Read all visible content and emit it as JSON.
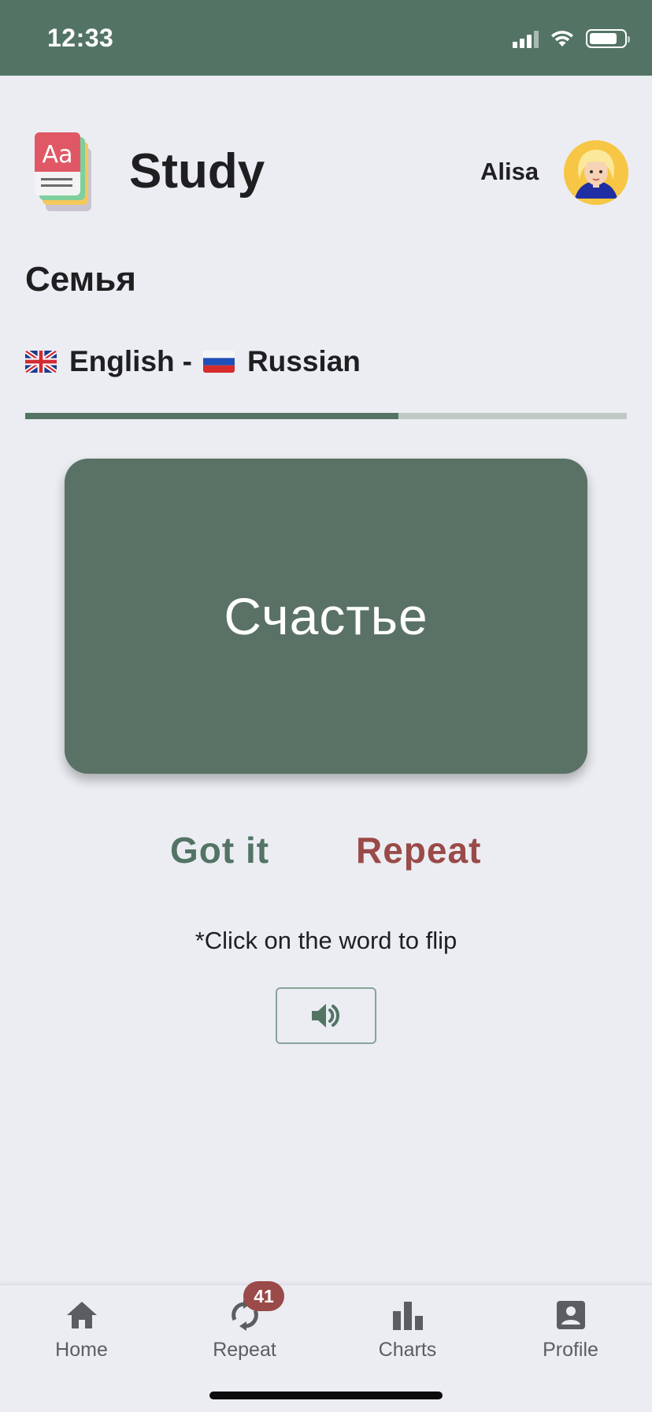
{
  "status_bar": {
    "time": "12:33"
  },
  "header": {
    "title": "Study",
    "user_name": "Alisa"
  },
  "set": {
    "title": "Семья",
    "source_language": "English",
    "separator": "-",
    "target_language": "Russian"
  },
  "progress": {
    "fraction": 0.62
  },
  "card": {
    "word": "Счастье"
  },
  "actions": {
    "got_it": "Got it",
    "repeat": "Repeat"
  },
  "hint": "*Click on the word to flip",
  "bottom_nav": {
    "items": [
      {
        "label": "Home",
        "icon": "home-icon"
      },
      {
        "label": "Repeat",
        "icon": "repeat-icon",
        "badge": "41"
      },
      {
        "label": "Charts",
        "icon": "chart-icon"
      },
      {
        "label": "Profile",
        "icon": "profile-icon"
      }
    ]
  },
  "colors": {
    "primary": "#537465",
    "card": "#5a7266",
    "repeat": "#9a4a48",
    "background": "#ebedf2"
  }
}
